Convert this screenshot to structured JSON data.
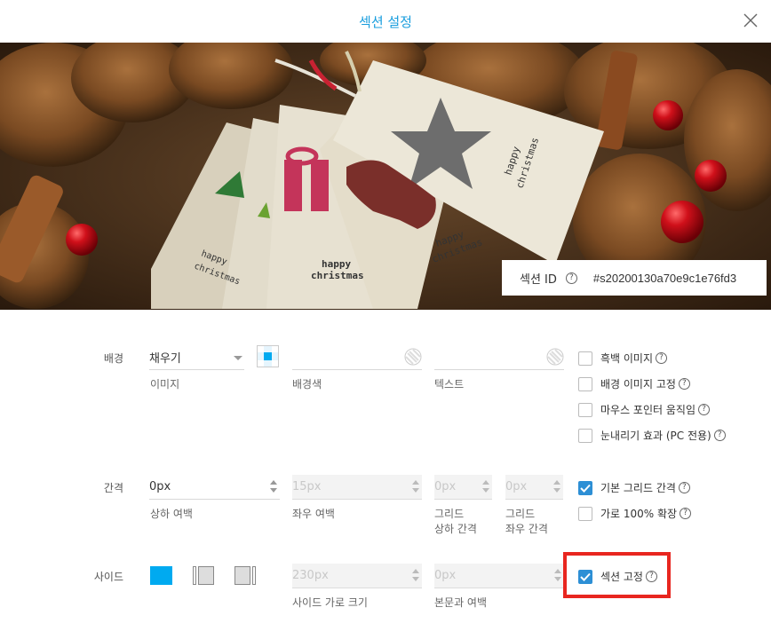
{
  "dialog": {
    "title": "섹션 설정"
  },
  "section_id": {
    "label": "섹션 ID",
    "help": "?",
    "value": "#s20200130a70e9c1e76fd3"
  },
  "hero_image": {
    "tag_text_line1": "happy",
    "tag_text_line2": "christmas"
  },
  "background": {
    "label": "배경",
    "fill_select": "채우기",
    "fill_caption": "이미지",
    "bg_color_caption": "배경색",
    "text_color_caption": "텍스트",
    "options": [
      {
        "label": "흑백 이미지",
        "checked": false
      },
      {
        "label": "배경 이미지 고정",
        "checked": false
      },
      {
        "label": "마우스 포인터 움직임",
        "checked": false
      },
      {
        "label": "눈내리기 효과 (PC 전용)",
        "checked": false
      }
    ]
  },
  "spacing": {
    "label": "간격",
    "vertical_value": "0px",
    "vertical_caption": "상하 여백",
    "horizontal_value": "15px",
    "horizontal_caption": "좌우 여백",
    "grid_v_value": "0px",
    "grid_v_caption_1": "그리드",
    "grid_v_caption_2": "상하 간격",
    "grid_h_value": "0px",
    "grid_h_caption_1": "그리드",
    "grid_h_caption_2": "좌우 간격",
    "options": [
      {
        "label": "기본 그리드 간격",
        "checked": true
      },
      {
        "label": "가로 100% 확장",
        "checked": false
      }
    ]
  },
  "side": {
    "label": "사이드",
    "width_value": "230px",
    "width_caption": "사이드 가로 크기",
    "margin_value": "0px",
    "margin_caption": "본문과 여백",
    "fixed_option": {
      "label": "섹션 고정",
      "checked": true
    }
  },
  "colors": {
    "accent": "#1a9ede",
    "checkbox_on": "#2d8fd5",
    "side_active": "#00aaf0",
    "highlight": "#e8261f"
  }
}
